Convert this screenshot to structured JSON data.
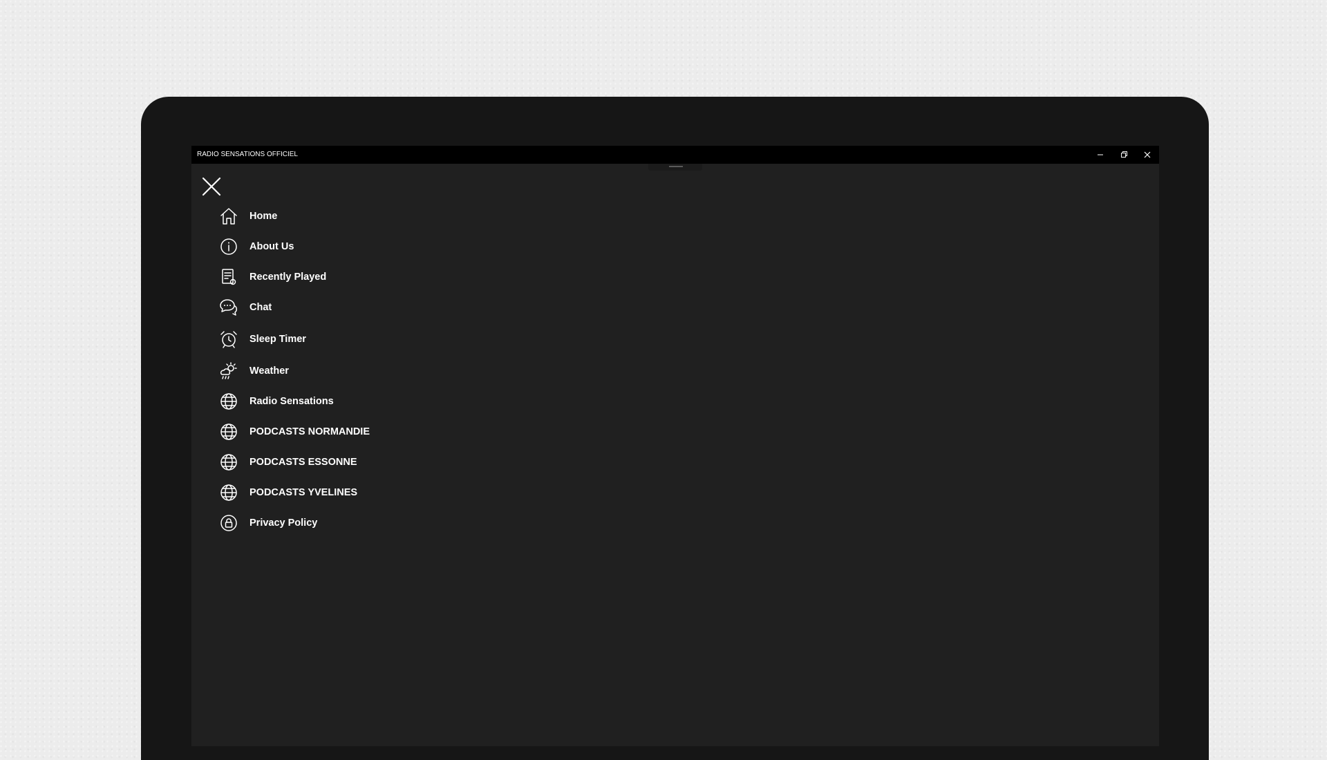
{
  "window": {
    "title": "RADIO SENSATIONS OFFICIEL"
  },
  "menu": {
    "items": [
      {
        "label": "Home",
        "icon": "home-icon"
      },
      {
        "label": "About Us",
        "icon": "info-icon"
      },
      {
        "label": "Recently Played",
        "icon": "recent-list-icon"
      },
      {
        "label": "Chat",
        "icon": "chat-icon"
      },
      {
        "label": "Sleep Timer",
        "icon": "alarm-clock-icon"
      },
      {
        "label": "Weather",
        "icon": "weather-icon"
      },
      {
        "label": "Radio Sensations",
        "icon": "globe-icon"
      },
      {
        "label": "PODCASTS NORMANDIE",
        "icon": "globe-icon"
      },
      {
        "label": "PODCASTS ESSONNE",
        "icon": "globe-icon"
      },
      {
        "label": "PODCASTS YVELINES",
        "icon": "globe-icon"
      },
      {
        "label": "Privacy Policy",
        "icon": "lock-icon"
      }
    ]
  },
  "colors": {
    "window_bg": "#202020",
    "titlebar_bg": "#000000",
    "text": "#ffffff",
    "device_bezel": "#161616"
  }
}
